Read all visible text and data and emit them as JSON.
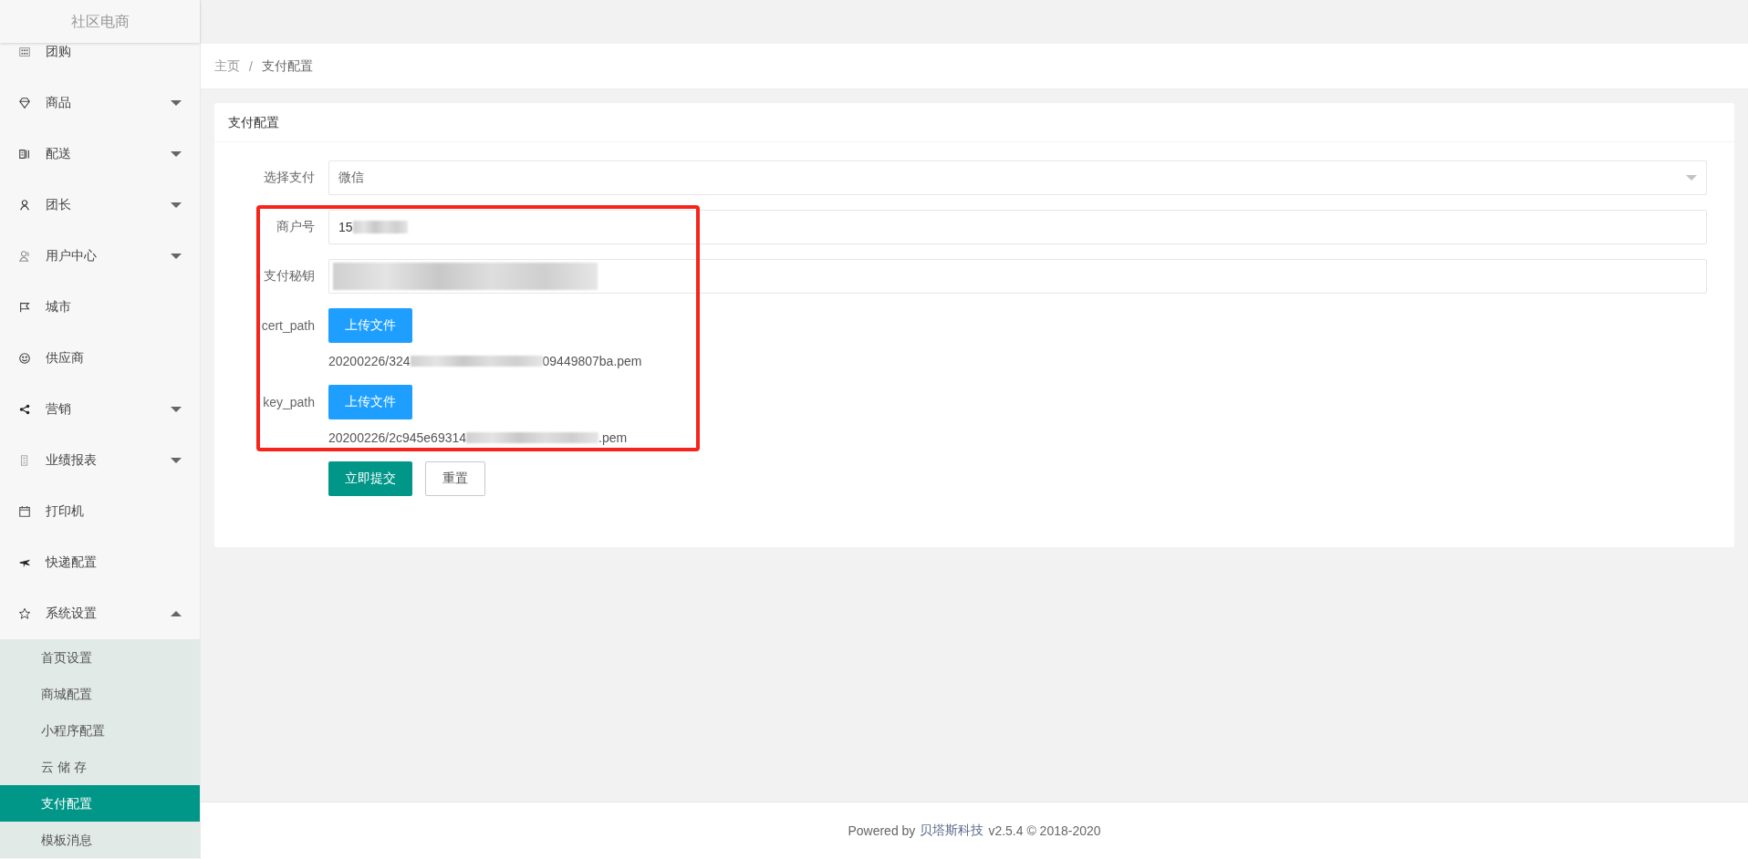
{
  "brand": "社区电商",
  "menu": [
    {
      "label": "团购"
    },
    {
      "label": "商品",
      "expanded": false
    },
    {
      "label": "配送",
      "expanded": false
    },
    {
      "label": "团长",
      "expanded": false
    },
    {
      "label": "用户中心",
      "expanded": false
    },
    {
      "label": "城市"
    },
    {
      "label": "供应商"
    },
    {
      "label": "营销",
      "expanded": false
    },
    {
      "label": "业绩报表",
      "expanded": false
    },
    {
      "label": "打印机"
    },
    {
      "label": "快递配置"
    },
    {
      "label": "系统设置",
      "expanded": true,
      "children": [
        {
          "label": "首页设置",
          "selected": false
        },
        {
          "label": "商城配置",
          "selected": false
        },
        {
          "label": "小程序配置",
          "selected": false
        },
        {
          "label": "云 储 存",
          "selected": false
        },
        {
          "label": "支付配置",
          "selected": true
        },
        {
          "label": "模板消息",
          "selected": false
        }
      ]
    }
  ],
  "breadcrumb": {
    "items": [
      "主页",
      "支付配置"
    ],
    "separator": "/"
  },
  "card_title": "支付配置",
  "form": [
    {
      "kind": "select",
      "label": "选择支付",
      "value": "微信"
    },
    {
      "kind": "input",
      "label": "商户号",
      "value": "15",
      "blurred": true
    },
    {
      "kind": "input",
      "label": "支付秘钥",
      "blurred": true
    },
    {
      "kind": "upload",
      "label": "cert_path",
      "button": "上传文件",
      "file_prefix": "20200226/324",
      "file_suffix": "09449807ba.pem"
    },
    {
      "kind": "upload",
      "label": "key_path",
      "button": "上传文件",
      "file_prefix": "20200226/2c945e69314",
      "file_suffix": ".pem"
    }
  ],
  "actions": {
    "submit": "立即提交",
    "reset": "重置"
  },
  "footer": {
    "prefix": "Powered by",
    "link": "贝塔斯科技",
    "suffix": "v2.5.4 © 2018-2020"
  }
}
